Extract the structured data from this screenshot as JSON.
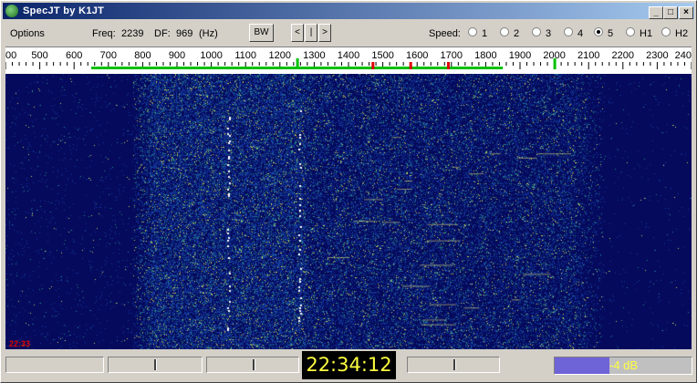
{
  "window": {
    "title": "SpecJT    by K1JT",
    "min_icon": "minimize-icon",
    "max_icon": "maximize-icon",
    "close_icon": "close-icon"
  },
  "menu": {
    "options": "Options"
  },
  "readout": {
    "freq_label": "Freq:",
    "freq_value": "2239",
    "df_label": "DF:",
    "df_value": "969",
    "unit": "(Hz)"
  },
  "buttons": {
    "bw": "BW",
    "prev": "<",
    "center": "|",
    "next": ">"
  },
  "speed": {
    "label": "Speed:",
    "options": [
      "1",
      "2",
      "3",
      "4",
      "5",
      "H1",
      "H2"
    ],
    "selected": "5"
  },
  "scale": {
    "ticks": [
      "00",
      "500",
      "600",
      "700",
      "800",
      "900",
      "1000",
      "1100",
      "1200",
      "1300",
      "1400",
      "1500",
      "1600",
      "1700",
      "1800",
      "1900",
      "2000",
      "2100",
      "2200",
      "2300",
      "240"
    ],
    "range_hz": [
      400,
      2400
    ],
    "green_band_hz": [
      650,
      1850
    ],
    "green_markers_hz": [
      1250,
      2000
    ],
    "red_markers_hz": [
      1470,
      1580,
      1690
    ],
    "colors": {
      "band": "#00c000",
      "red": "#e00000",
      "tick": "#000000"
    }
  },
  "waterfall": {
    "timestamp": "22:33",
    "bg_color": "#050a5c"
  },
  "status": {
    "clock": "22:34:12",
    "level_text": "-4 dB",
    "level_fraction": 0.4
  }
}
